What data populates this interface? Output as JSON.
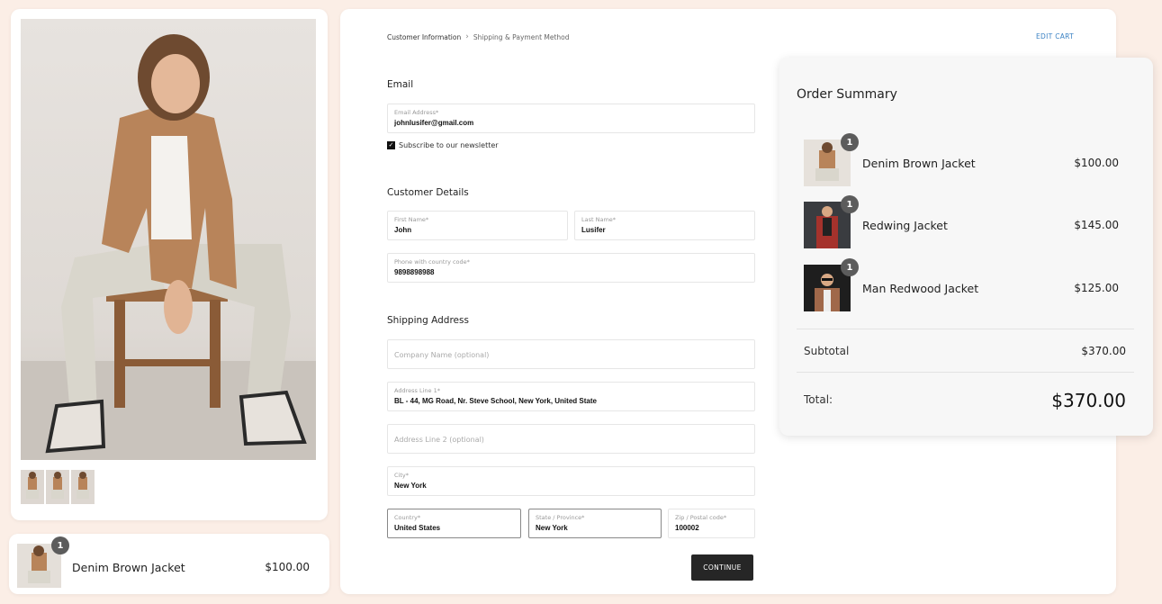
{
  "breadcrumb": {
    "step1": "Customer Information",
    "step2": "Shipping & Payment Method",
    "chevron": "›"
  },
  "edit_cart": "EDIT CART",
  "email_section": {
    "title": "Email",
    "email_label": "Email Address*",
    "email_value": "johnlusifer@gmail.com",
    "newsletter_label": "Subscribe to our newsletter",
    "newsletter_checked": true
  },
  "customer_details": {
    "title": "Customer Details",
    "first_name_label": "First Name*",
    "first_name_value": "John",
    "last_name_label": "Last Name*",
    "last_name_value": "Lusifer",
    "phone_label": "Phone with country code*",
    "phone_value": "9898898988"
  },
  "shipping_address": {
    "title": "Shipping Address",
    "company_placeholder": "Company Name (optional)",
    "address1_label": "Address Line 1*",
    "address1_value": "BL - 44, MG Road, Nr. Steve School, New York, United State",
    "address2_placeholder": "Address Line 2 (optional)",
    "city_label": "City*",
    "city_value": "New York",
    "country_label": "Country*",
    "country_value": "United States",
    "state_label": "State / Province*",
    "state_value": "New York",
    "zip_label": "Zip / Postal code*",
    "zip_value": "100002"
  },
  "continue_label": "CONTINUE",
  "mini_cart": {
    "qty": "1",
    "name": "Denim Brown Jacket",
    "price": "$100.00"
  },
  "order_summary": {
    "title": "Order Summary",
    "items": [
      {
        "qty": "1",
        "name": "Denim Brown Jacket",
        "price": "$100.00"
      },
      {
        "qty": "1",
        "name": "Redwing Jacket",
        "price": "$145.00"
      },
      {
        "qty": "1",
        "name": "Man Redwood Jacket",
        "price": "$125.00"
      }
    ],
    "subtotal_label": "Subtotal",
    "subtotal_value": "$370.00",
    "total_label": "Total:",
    "total_value": "$370.00"
  },
  "colors": {
    "page_background": "#fbeee6",
    "accent_link": "#3b82c4",
    "button": "#262626",
    "badge": "#5c5c5c"
  },
  "icons": [
    "chevron-right-icon",
    "checkbox-checked-icon"
  ]
}
